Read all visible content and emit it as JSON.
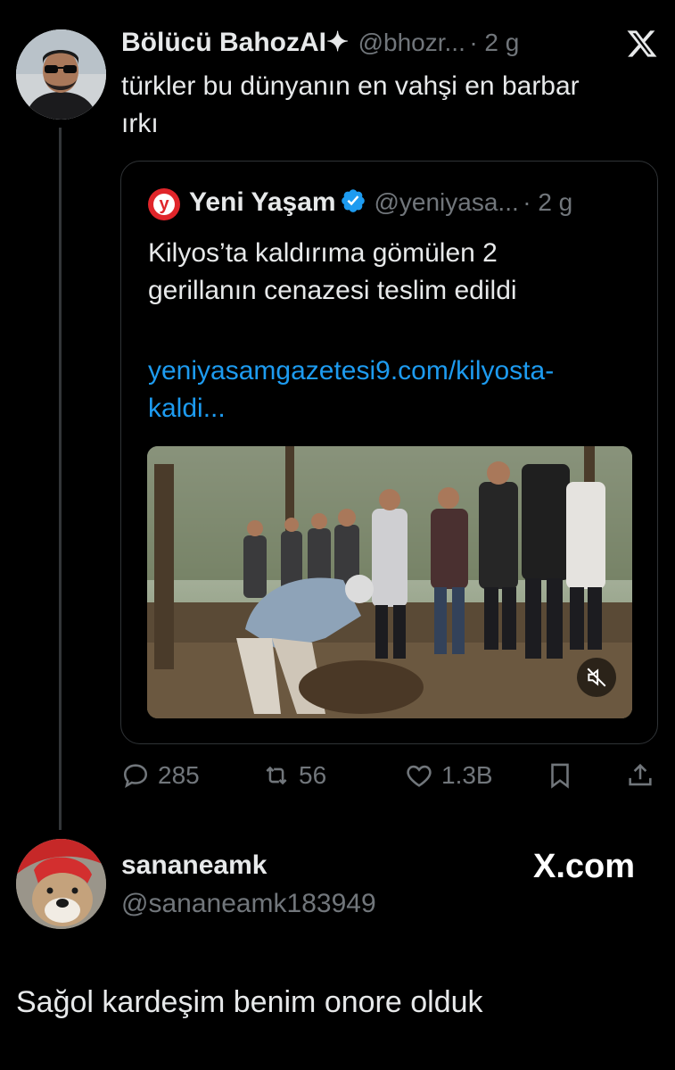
{
  "tweet": {
    "author_name": "Bölücü BahozAI✦",
    "author_handle": "@bhozr...",
    "time": "· 2 g",
    "text_line1": "türkler bu dünyanın en vahşi en barbar",
    "text_line2": "ırkı"
  },
  "quote": {
    "author_name": "Yeni Yaşam",
    "author_handle": "@yeniyasa...",
    "time": "· 2 g",
    "text_line1": "Kilyos’ta kaldırıma gömülen 2",
    "text_line2": "gerillanın cenazesi teslim edildi",
    "link_line1": "yeniyasamgazetesi9.com/kilyosta-",
    "link_line2": "kaldi...",
    "logo_letter": "y"
  },
  "actions": {
    "replies": "285",
    "reposts": "56",
    "likes": "1.3B"
  },
  "reply": {
    "author_name": "sananeamk",
    "author_handle": "@sananeamk183949",
    "text": "Sağol kardeşim benim onore olduk"
  },
  "brand": {
    "x_com": "X.com"
  },
  "icons": [
    "x-logo-icon",
    "verified-badge-icon",
    "reply-icon",
    "repost-icon",
    "like-icon",
    "bookmark-icon",
    "share-icon",
    "mute-icon"
  ],
  "colors": {
    "background": "#000000",
    "text": "#e7e9ea",
    "muted": "#71767b",
    "link": "#1d9bf0",
    "verified": "#1d9bf0",
    "logo_red": "#e0252a"
  }
}
